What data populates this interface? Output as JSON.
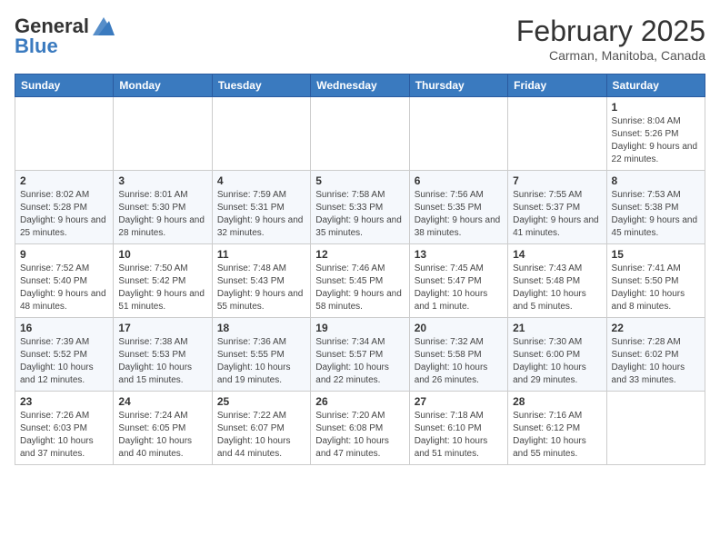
{
  "header": {
    "logo_general": "General",
    "logo_blue": "Blue",
    "title": "February 2025",
    "subtitle": "Carman, Manitoba, Canada"
  },
  "weekdays": [
    "Sunday",
    "Monday",
    "Tuesday",
    "Wednesday",
    "Thursday",
    "Friday",
    "Saturday"
  ],
  "weeks": [
    [
      {
        "day": "",
        "info": ""
      },
      {
        "day": "",
        "info": ""
      },
      {
        "day": "",
        "info": ""
      },
      {
        "day": "",
        "info": ""
      },
      {
        "day": "",
        "info": ""
      },
      {
        "day": "",
        "info": ""
      },
      {
        "day": "1",
        "info": "Sunrise: 8:04 AM\nSunset: 5:26 PM\nDaylight: 9 hours and 22 minutes."
      }
    ],
    [
      {
        "day": "2",
        "info": "Sunrise: 8:02 AM\nSunset: 5:28 PM\nDaylight: 9 hours and 25 minutes."
      },
      {
        "day": "3",
        "info": "Sunrise: 8:01 AM\nSunset: 5:30 PM\nDaylight: 9 hours and 28 minutes."
      },
      {
        "day": "4",
        "info": "Sunrise: 7:59 AM\nSunset: 5:31 PM\nDaylight: 9 hours and 32 minutes."
      },
      {
        "day": "5",
        "info": "Sunrise: 7:58 AM\nSunset: 5:33 PM\nDaylight: 9 hours and 35 minutes."
      },
      {
        "day": "6",
        "info": "Sunrise: 7:56 AM\nSunset: 5:35 PM\nDaylight: 9 hours and 38 minutes."
      },
      {
        "day": "7",
        "info": "Sunrise: 7:55 AM\nSunset: 5:37 PM\nDaylight: 9 hours and 41 minutes."
      },
      {
        "day": "8",
        "info": "Sunrise: 7:53 AM\nSunset: 5:38 PM\nDaylight: 9 hours and 45 minutes."
      }
    ],
    [
      {
        "day": "9",
        "info": "Sunrise: 7:52 AM\nSunset: 5:40 PM\nDaylight: 9 hours and 48 minutes."
      },
      {
        "day": "10",
        "info": "Sunrise: 7:50 AM\nSunset: 5:42 PM\nDaylight: 9 hours and 51 minutes."
      },
      {
        "day": "11",
        "info": "Sunrise: 7:48 AM\nSunset: 5:43 PM\nDaylight: 9 hours and 55 minutes."
      },
      {
        "day": "12",
        "info": "Sunrise: 7:46 AM\nSunset: 5:45 PM\nDaylight: 9 hours and 58 minutes."
      },
      {
        "day": "13",
        "info": "Sunrise: 7:45 AM\nSunset: 5:47 PM\nDaylight: 10 hours and 1 minute."
      },
      {
        "day": "14",
        "info": "Sunrise: 7:43 AM\nSunset: 5:48 PM\nDaylight: 10 hours and 5 minutes."
      },
      {
        "day": "15",
        "info": "Sunrise: 7:41 AM\nSunset: 5:50 PM\nDaylight: 10 hours and 8 minutes."
      }
    ],
    [
      {
        "day": "16",
        "info": "Sunrise: 7:39 AM\nSunset: 5:52 PM\nDaylight: 10 hours and 12 minutes."
      },
      {
        "day": "17",
        "info": "Sunrise: 7:38 AM\nSunset: 5:53 PM\nDaylight: 10 hours and 15 minutes."
      },
      {
        "day": "18",
        "info": "Sunrise: 7:36 AM\nSunset: 5:55 PM\nDaylight: 10 hours and 19 minutes."
      },
      {
        "day": "19",
        "info": "Sunrise: 7:34 AM\nSunset: 5:57 PM\nDaylight: 10 hours and 22 minutes."
      },
      {
        "day": "20",
        "info": "Sunrise: 7:32 AM\nSunset: 5:58 PM\nDaylight: 10 hours and 26 minutes."
      },
      {
        "day": "21",
        "info": "Sunrise: 7:30 AM\nSunset: 6:00 PM\nDaylight: 10 hours and 29 minutes."
      },
      {
        "day": "22",
        "info": "Sunrise: 7:28 AM\nSunset: 6:02 PM\nDaylight: 10 hours and 33 minutes."
      }
    ],
    [
      {
        "day": "23",
        "info": "Sunrise: 7:26 AM\nSunset: 6:03 PM\nDaylight: 10 hours and 37 minutes."
      },
      {
        "day": "24",
        "info": "Sunrise: 7:24 AM\nSunset: 6:05 PM\nDaylight: 10 hours and 40 minutes."
      },
      {
        "day": "25",
        "info": "Sunrise: 7:22 AM\nSunset: 6:07 PM\nDaylight: 10 hours and 44 minutes."
      },
      {
        "day": "26",
        "info": "Sunrise: 7:20 AM\nSunset: 6:08 PM\nDaylight: 10 hours and 47 minutes."
      },
      {
        "day": "27",
        "info": "Sunrise: 7:18 AM\nSunset: 6:10 PM\nDaylight: 10 hours and 51 minutes."
      },
      {
        "day": "28",
        "info": "Sunrise: 7:16 AM\nSunset: 6:12 PM\nDaylight: 10 hours and 55 minutes."
      },
      {
        "day": "",
        "info": ""
      }
    ]
  ]
}
